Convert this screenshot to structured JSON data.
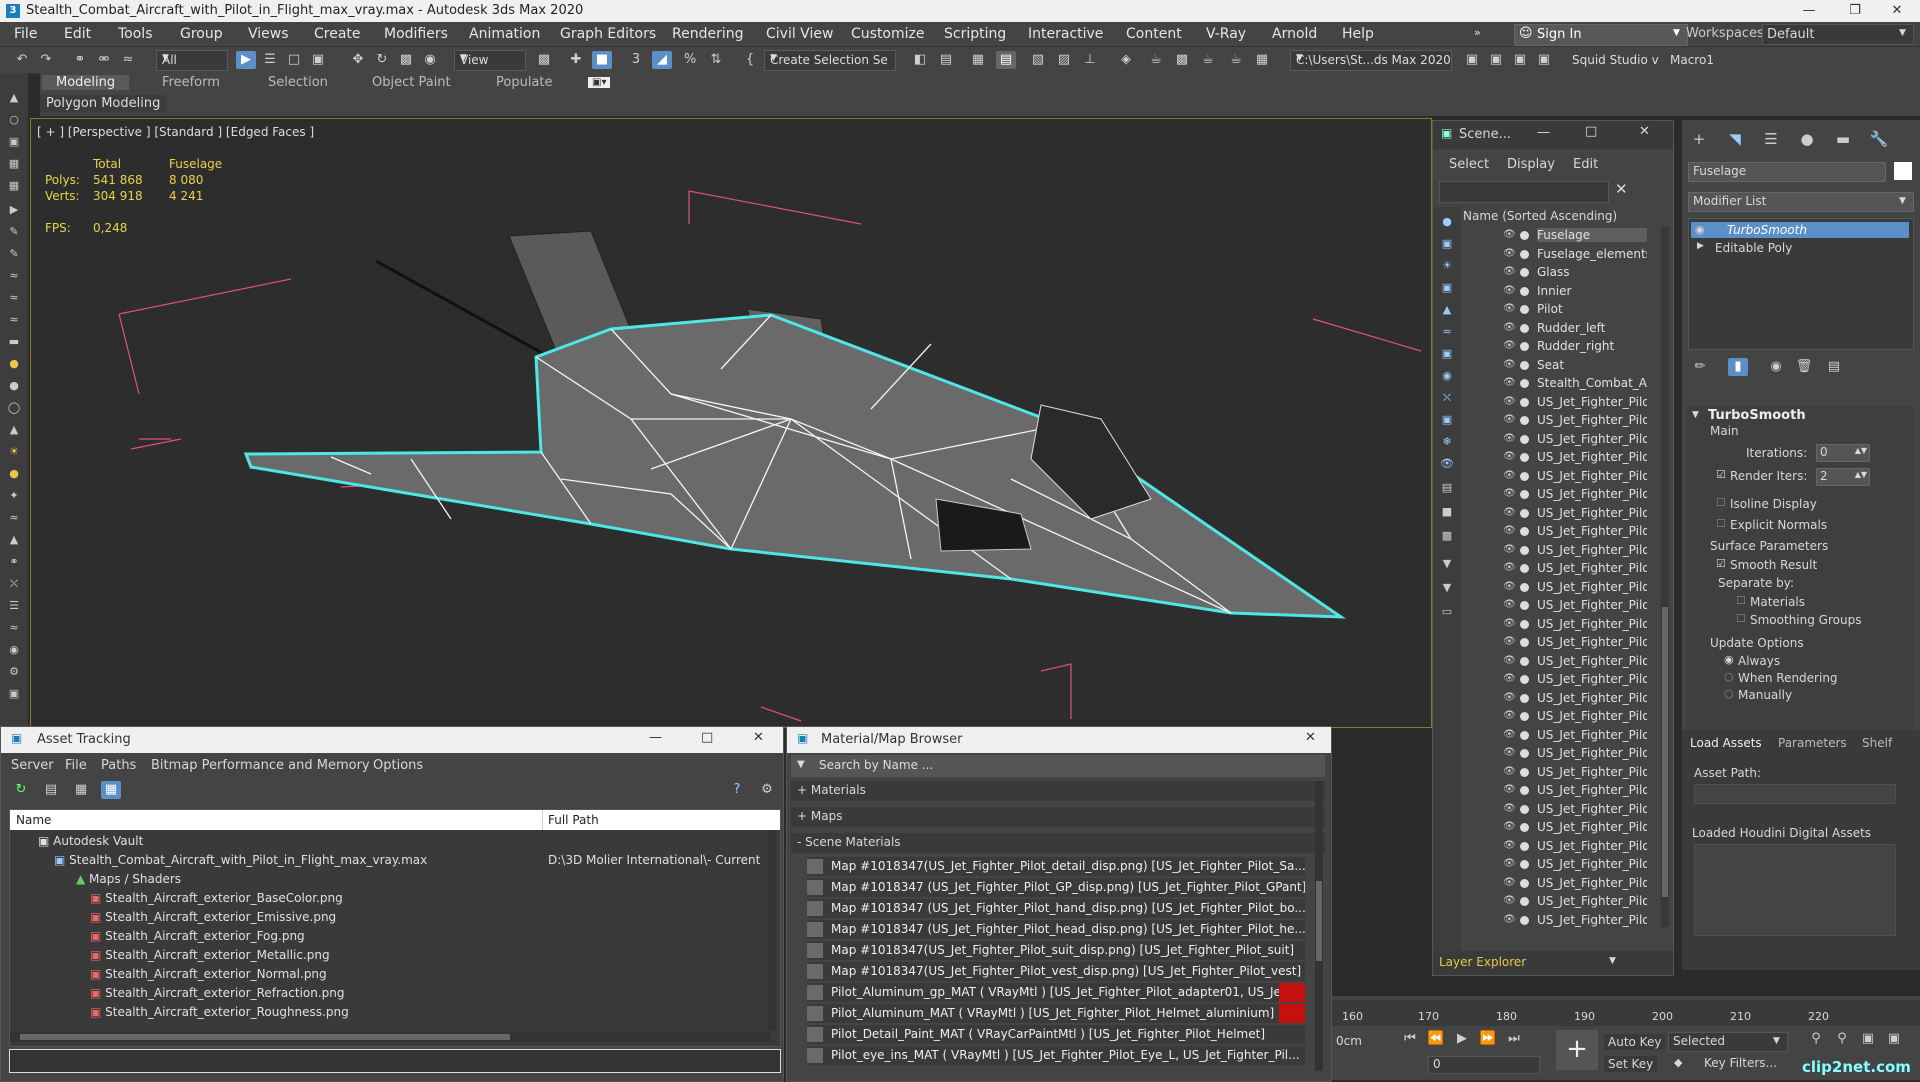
{
  "title": "Stealth_Combat_Aircraft_with_Pilot_in_Flight_max_vray.max - Autodesk 3ds Max 2020",
  "menu": [
    "File",
    "Edit",
    "Tools",
    "Group",
    "Views",
    "Create",
    "Modifiers",
    "Animation",
    "Graph Editors",
    "Rendering",
    "Civil View",
    "Customize",
    "Scripting",
    "Interactive",
    "Content",
    "V-Ray",
    "Arnold",
    "Help"
  ],
  "signin": "Sign In",
  "workspaces_label": "Workspaces:",
  "workspace_value": "Default",
  "toolbar": {
    "filter": "All",
    "view": "View",
    "selection_set": "Create Selection Se",
    "path": "C:\\Users\\St...ds Max 2020",
    "studio": "Squid Studio v",
    "macro": "Macro1"
  },
  "ribbon": {
    "tabs": [
      "Modeling",
      "Freeform",
      "Selection",
      "Object Paint",
      "Populate"
    ],
    "panel": "Polygon Modeling"
  },
  "viewport": {
    "label": "[ + ] [Perspective ] [Standard ] [Edged Faces ]",
    "stats": {
      "col_total": "Total",
      "col_obj": "Fuselage",
      "polys_label": "Polys:",
      "polys_total": "541 868",
      "polys_obj": "8 080",
      "verts_label": "Verts:",
      "verts_total": "304 918",
      "verts_obj": "4 241",
      "fps_label": "FPS:",
      "fps": "0,248"
    }
  },
  "scene": {
    "title": "Scene...",
    "menu": [
      "Select",
      "Display",
      "Edit"
    ],
    "column": "Name (Sorted Ascending)",
    "items": [
      "Fuselage",
      "Fuselage_elements",
      "Glass",
      "Innier",
      "Pilot",
      "Rudder_left",
      "Rudder_right",
      "Seat",
      "Stealth_Combat_Air",
      "US_Jet_Fighter_Pilo",
      "US_Jet_Fighter_Pilo",
      "US_Jet_Fighter_Pilo",
      "US_Jet_Fighter_Pilo",
      "US_Jet_Fighter_Pilo",
      "US_Jet_Fighter_Pilo",
      "US_Jet_Fighter_Pilo",
      "US_Jet_Fighter_Pilo",
      "US_Jet_Fighter_Pilo",
      "US_Jet_Fighter_Pilo",
      "US_Jet_Fighter_Pilo",
      "US_Jet_Fighter_Pilo",
      "US_Jet_Fighter_Pilo",
      "US_Jet_Fighter_Pilo",
      "US_Jet_Fighter_Pilo",
      "US_Jet_Fighter_Pilo",
      "US_Jet_Fighter_Pilo",
      "US_Jet_Fighter_Pilo",
      "US_Jet_Fighter_Pilo",
      "US_Jet_Fighter_Pilo",
      "US_Jet_Fighter_Pilo",
      "US_Jet_Fighter_Pilo",
      "US_Jet_Fighter_Pilo",
      "US_Jet_Fighter_Pilo",
      "US_Jet_Fighter_Pilo",
      "US_Jet_Fighter_Pilo",
      "US_Jet_Fighter_Pilo",
      "US_Jet_Fighter_Pilo",
      "US_Jet_Fighter_Pilo"
    ],
    "footer": "Layer Explorer"
  },
  "command": {
    "object_name": "Fuselage",
    "modifier_list": "Modifier List",
    "stack": [
      "TurboSmooth",
      "Editable Poly"
    ],
    "rollout": "TurboSmooth",
    "main": "Main",
    "iterations_label": "Iterations:",
    "iterations": "0",
    "render_iters_label": "Render Iters:",
    "render_iters": "2",
    "isoline": "Isoline Display",
    "explicit": "Explicit Normals",
    "surface": "Surface Parameters",
    "smooth_result": "Smooth Result",
    "separate_by": "Separate by:",
    "materials": "Materials",
    "smoothing_groups": "Smoothing Groups",
    "update_options": "Update Options",
    "always": "Always",
    "when_rendering": "When Rendering",
    "manually": "Manually",
    "houdini_tabs": [
      "Load Assets",
      "Parameters",
      "Shelf"
    ],
    "asset_path": "Asset Path:",
    "loaded": "Loaded Houdini Digital Assets"
  },
  "asset": {
    "title": "Asset Tracking",
    "menu": [
      "Server",
      "File",
      "Paths",
      "Bitmap Performance and Memory",
      "Options"
    ],
    "col_name": "Name",
    "col_path": "Full Path",
    "vault": "Autodesk Vault",
    "file": "Stealth_Combat_Aircraft_with_Pilot_in_Flight_max_vray.max",
    "file_path": "D:\\3D Molier International\\- Current",
    "maps": "Maps / Shaders",
    "bitmaps": [
      "Stealth_Aircraft_exterior_BaseColor.png",
      "Stealth_Aircraft_exterior_Emissive.png",
      "Stealth_Aircraft_exterior_Fog.png",
      "Stealth_Aircraft_exterior_Metallic.png",
      "Stealth_Aircraft_exterior_Normal.png",
      "Stealth_Aircraft_exterior_Refraction.png",
      "Stealth_Aircraft_exterior_Roughness.png"
    ]
  },
  "matbrowser": {
    "title": "Material/Map Browser",
    "search": "Search by Name ...",
    "groups": [
      "+ Materials",
      "+ Maps",
      "- Scene Materials"
    ],
    "items": [
      "Map #1018347(US_Jet_Fighter_Pilot_detail_disp.png) [US_Jet_Fighter_Pilot_Sa...",
      "Map #1018347 (US_Jet_Fighter_Pilot_GP_disp.png) [US_Jet_Fighter_Pilot_GPant]",
      "Map #1018347 (US_Jet_Fighter_Pilot_hand_disp.png) [US_Jet_Fighter_Pilot_bo...",
      "Map #1018347 (US_Jet_Fighter_Pilot_head_disp.png) [US_Jet_Fighter_Pilot_he...",
      "Map #1018347(US_Jet_Fighter_Pilot_suit_disp.png) [US_Jet_Fighter_Pilot_suit]",
      "Map #1018347(US_Jet_Fighter_Pilot_vest_disp.png) [US_Jet_Fighter_Pilot_vest]",
      "Pilot_Aluminum_gp_MAT ( VRayMtl ) [US_Jet_Fighter_Pilot_adapter01, US_Jet_...",
      "Pilot_Aluminum_MAT ( VRayMtl ) [US_Jet_Fighter_Pilot_Helmet_aluminium]",
      "Pilot_Detail_Paint_MAT ( VRayCarPaintMtl ) [US_Jet_Fighter_Pilot_Helmet]",
      "Pilot_eye_ins_MAT ( VRayMtl ) [US_Jet_Fighter_Pilot_Eye_L, US_Jet_Fighter_Pil..."
    ]
  },
  "timeline": {
    "ticks": [
      "160",
      "170",
      "180",
      "190",
      "200",
      "210",
      "220"
    ],
    "auto_key": "Auto Key",
    "set_key": "Set Key",
    "selected": "Selected",
    "key_filters": "Key Filters...",
    "frame": "0",
    "units": "0cm"
  },
  "watermark": "clip2net.com",
  "colors": {
    "accent": "#5b8fc7",
    "wire": "#4ee6e6",
    "bbox": "#e0507a",
    "stats": "#e8d34a"
  }
}
